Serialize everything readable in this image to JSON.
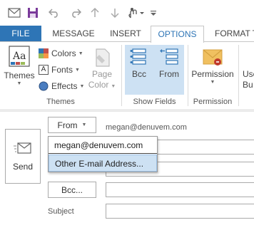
{
  "tabs": [
    {
      "label": "FILE"
    },
    {
      "label": "MESSAGE"
    },
    {
      "label": "INSERT"
    },
    {
      "label": "OPTIONS"
    },
    {
      "label": "FORMAT T"
    }
  ],
  "ribbon": {
    "themes_group": {
      "themes_label": "Themes",
      "colors_label": "Colors",
      "fonts_label": "Fonts",
      "effects_label": "Effects",
      "page_color_line1": "Page",
      "page_color_line2": "Color",
      "group_label": "Themes"
    },
    "show_fields_group": {
      "bcc_label": "Bcc",
      "from_label": "From",
      "group_label": "Show Fields"
    },
    "permission_group": {
      "permission_label": "Permission",
      "group_label": "Permission"
    },
    "cutoff_line1": "Use",
    "cutoff_line2": "Bu"
  },
  "compose": {
    "send_label": "Send",
    "from_button_label": "From",
    "from_address": "megan@denuvem.com",
    "bcc_button_label": "Bcc...",
    "subject_label": "Subject"
  },
  "dropdown": {
    "items": [
      {
        "label": "megan@denuvem.com"
      },
      {
        "label": "Other E-mail Address..."
      }
    ]
  },
  "colors": {
    "accent": "#2e75b6",
    "highlight": "#cde1f3",
    "save_icon": "#7a3a9a"
  }
}
